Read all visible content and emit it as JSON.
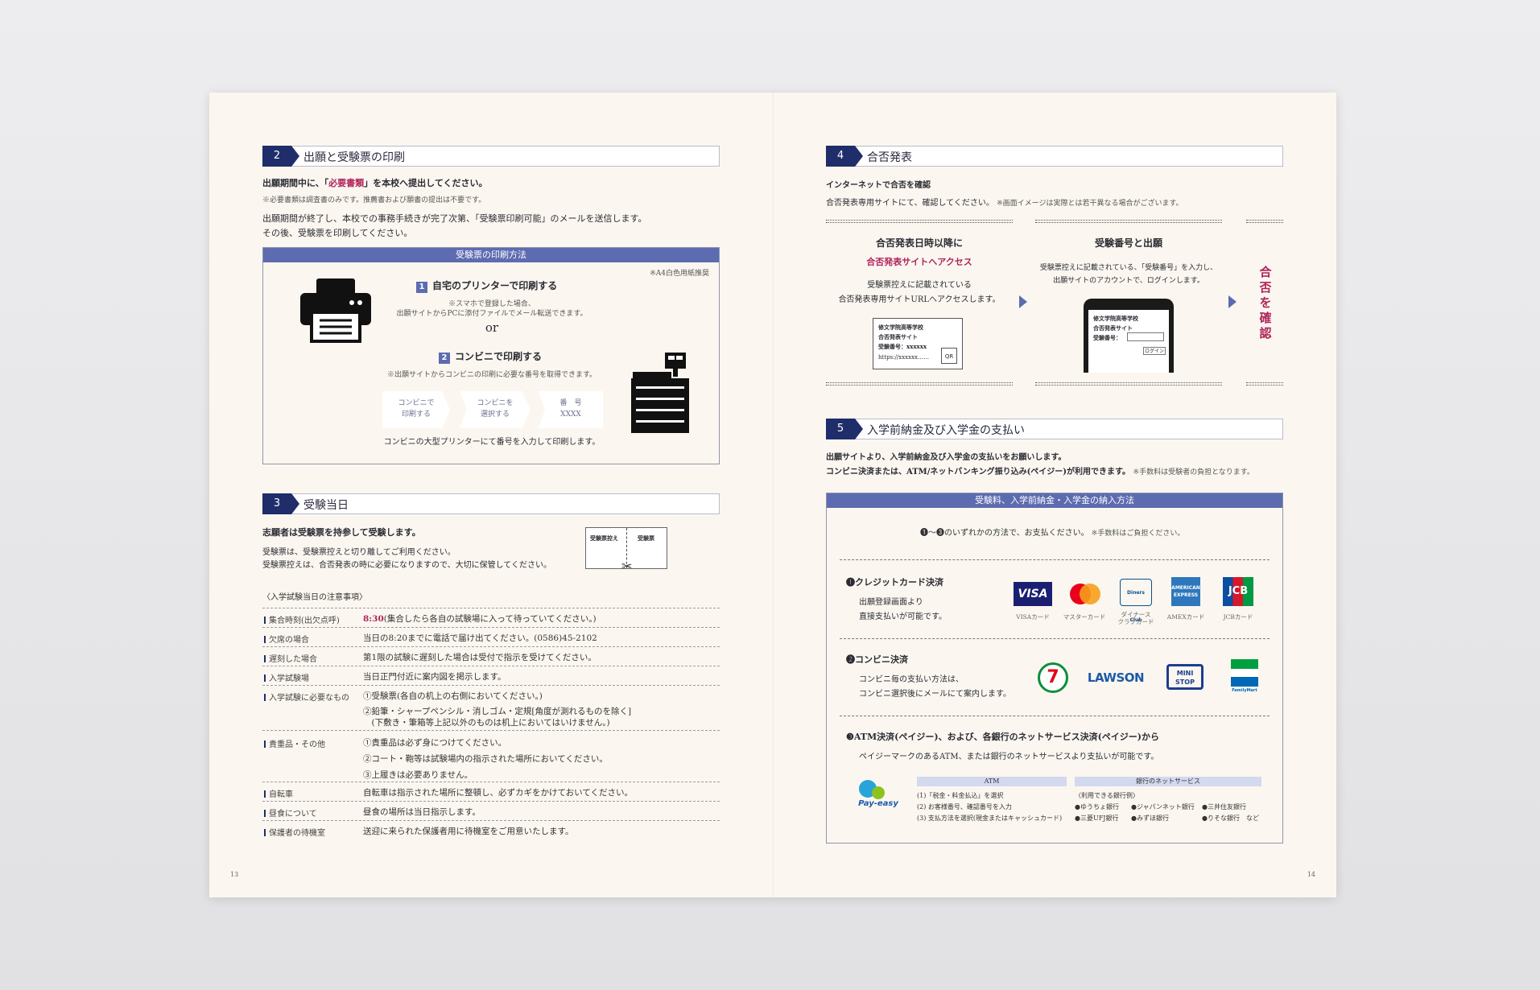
{
  "left": {
    "page_number": "13",
    "sec2": {
      "num": "2",
      "title": "出願と受験票の印刷",
      "lead_a": "出願期間中に、「",
      "lead_link": "必要書類",
      "lead_b": "」を本校へ提出してください。",
      "note": "※必要書類は調査書のみです。推薦書および願書の提出は不要です。",
      "p1": "出願期間が終了し、本校での事務手続きが完了次第、「受験票印刷可能」のメールを送信します。",
      "p2": "その後、受験票を印刷してください。",
      "box": {
        "head": "受験票の印刷方法",
        "paper_note": "※A4白色用紙推奨",
        "opt1_num": "1",
        "opt1_title": "自宅のプリンターで印刷する",
        "opt1_note1": "※スマホで登録した場合、",
        "opt1_note2": "出願サイトからPCに添付ファイルでメール転送できます。",
        "or": "or",
        "opt2_num": "2",
        "opt2_title": "コンビニで印刷する",
        "opt2_note": "※出願サイトからコンビニの印刷に必要な番号を取得できます。",
        "steps": [
          [
            "コンビニで",
            "印刷する"
          ],
          [
            "コンビニを",
            "選択する"
          ],
          [
            "番　号",
            "XXXX"
          ]
        ],
        "footer": "コンビニの大型プリンターにて番号を入力して印刷します。"
      }
    },
    "sec3": {
      "num": "3",
      "title": "受験当日",
      "lead": "志願者は受験票を持参して受験します。",
      "p1": "受験票は、受験票控えと切り離してご利用ください。",
      "p2": "受験票控えは、合否発表の時に必要になりますので、大切に保管してください。",
      "ticket_left": "受験票控え",
      "ticket_right": "受験票",
      "notice_title": "〈入学試験当日の注意事項〉",
      "rows": [
        {
          "label": "集合時刻(出欠点呼)",
          "lines": [
            "8:30(集合したら各自の試験場に入って待っていてください。)"
          ]
        },
        {
          "label": "欠席の場合",
          "lines": [
            "当日の8:20までに電話で届け出てください。(0586)45-2102"
          ]
        },
        {
          "label": "遅刻した場合",
          "lines": [
            "第1限の試験に遅刻した場合は受付で指示を受けてください。"
          ]
        },
        {
          "label": "入学試験場",
          "lines": [
            "当日正門付近に案内図を掲示します。"
          ]
        },
        {
          "label": "入学試験に必要なもの",
          "lines": [
            "①受験票(各自の机上の右側においてください。)",
            "②鉛筆・シャープペンシル・消しゴム・定規[角度が測れるものを除く]",
            "　(下敷き・筆箱等上記以外のものは机上においてはいけません。)"
          ]
        },
        {
          "label": "貴重品・その他",
          "lines": [
            "①貴重品は必ず身につけてください。",
            "②コート・鞄等は試験場内の指示された場所においてください。",
            "③上履きは必要ありません。"
          ]
        },
        {
          "label": "自転車",
          "lines": [
            "自転車は指示された場所に整頓し、必ずカギをかけておいてください。"
          ]
        },
        {
          "label": "昼食について",
          "lines": [
            "昼食の場所は当日指示します。"
          ]
        },
        {
          "label": "保護者の待機室",
          "lines": [
            "送迎に来られた保護者用に待機室をご用意いたします。"
          ]
        }
      ]
    }
  },
  "right": {
    "page_number": "14",
    "sec4": {
      "num": "4",
      "title": "合否発表",
      "lead": "インターネットで合否を確認",
      "p1": "合否発表専用サイトにて、確認してください。",
      "p1_note": "※画面イメージは実際とは若干異なる場合がございます。",
      "col1_title": "合否発表日時以降に",
      "col1_sub": "合否発表サイトへアクセス",
      "col1_p1": "受験票控えに記載されている",
      "col1_p2": "合否発表専用サイトURLへアクセスします。",
      "screen1": [
        "修文学院高等学校",
        "合否発表サイト",
        "受験番号：xxxxxx",
        "https://xxxxxx……"
      ],
      "qr": "QR",
      "col2_title": "受験番号と出願",
      "col2_p1": "受験票控えに記載されている、「受験番号」を入力し、",
      "col2_p2": "出願サイトのアカウントで、ログインします。",
      "screen2": [
        "修文学院高等学校",
        "合否発表サイト",
        "受験番号："
      ],
      "login": "ログイン",
      "confirm": "合否を確認"
    },
    "sec5": {
      "num": "5",
      "title": "入学前納金及び入学金の支払い",
      "lead1": "出願サイトより、入学前納金及び入学金の支払いをお願いします。",
      "lead2": "コンビニ決済または、ATM/ネットバンキング振り込み(ペイジー)が利用できます。",
      "lead2_note": "※手数料は受験者の負担となります。",
      "box_head": "受験料、入学前納金・入学金の納入方法",
      "intro": "❶～❸のいずれかの方法で、お支払ください。",
      "intro_note": "※手数料はご負担ください。",
      "m1_title": "❶クレジットカード決済",
      "m1_p1": "出願登録画面より",
      "m1_p2": "直接支払いが可能です。",
      "cards": [
        {
          "logo": "VISA",
          "caption": "VISAカード"
        },
        {
          "logo": "mastercard",
          "caption": "マスターカード"
        },
        {
          "logo": "Diners Club",
          "caption": "ダイナース\nクラブカード"
        },
        {
          "logo": "AMERICAN EXPRESS",
          "caption": "AMEXカード"
        },
        {
          "logo": "JCB",
          "caption": "JCBカード"
        }
      ],
      "m2_title": "❷コンビニ決済",
      "m2_p1": "コンビニ毎の支払い方法は、",
      "m2_p2": "コンビニ選択後にメールにて案内します。",
      "stores": {
        "seven": "7",
        "lawson": "LAWSON",
        "ministop": "MINI STOP",
        "familymart": "FamilyMart"
      },
      "m3_title": "❸ATM決済(ペイジー)、および、各銀行のネットサービス決済(ペイジー)から",
      "m3_p": "ペイジーマークのあるATM、または銀行のネットサービスより支払いが可能です。",
      "payeasy": "Pay-easy",
      "atm_head": "ATM",
      "atm_lines": [
        "(1)「税金・料金払込」を選択",
        "(2) お客様番号、確認番号を入力",
        "(3) 支払方法を選択(現金またはキャッシュカード)"
      ],
      "bank_head": "銀行のネットサービス",
      "bank_note": "〈利用できる銀行例〉",
      "banks_row1": [
        "●ゆうちょ銀行",
        "●ジャパンネット銀行",
        "●三井住友銀行"
      ],
      "banks_row2": [
        "●三菱UFJ銀行",
        "●みずほ銀行",
        "●りそな銀行　など"
      ]
    }
  },
  "colors": {
    "navy": "#1f2d6b",
    "accent": "#5d6bb0",
    "pink": "#b0245b",
    "paper": "#fbf7f0"
  }
}
